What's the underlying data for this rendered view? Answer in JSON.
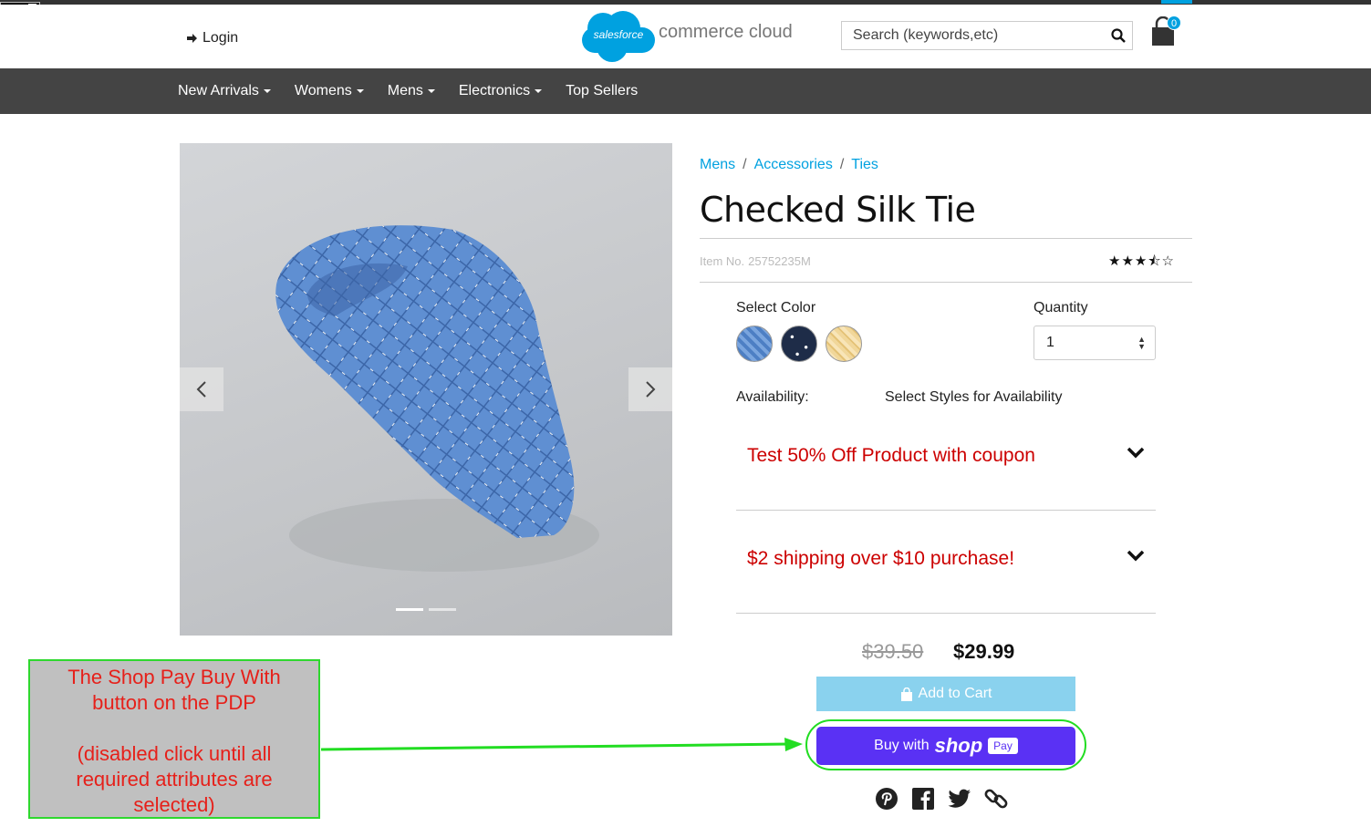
{
  "toolbox": {
    "icon": "tools-icon",
    "close": "×"
  },
  "header": {
    "login_label": "Login",
    "logo_cloud_text": "salesforce",
    "logo_text": "commerce cloud",
    "search_placeholder": "Search (keywords,etc)",
    "cart_count": "0"
  },
  "nav": {
    "items": [
      {
        "label": "New Arrivals"
      },
      {
        "label": "Womens"
      },
      {
        "label": "Mens"
      },
      {
        "label": "Electronics"
      },
      {
        "label": "Top Sellers"
      }
    ]
  },
  "product": {
    "breadcrumb": [
      "Mens",
      "Accessories",
      "Ties"
    ],
    "breadcrumb_sep": "/",
    "title": "Checked Silk Tie",
    "item_no_label": "Item No.",
    "item_no": "25752235M",
    "rating": 3.5,
    "rating_stars": "★★★⯪☆",
    "select_color_label": "Select Color",
    "colors": [
      "blue",
      "navy",
      "yellow"
    ],
    "quantity_label": "Quantity",
    "quantity_value": "1",
    "availability_label": "Availability:",
    "availability_value": "Select Styles for Availability",
    "promotions": [
      {
        "text": "Test 50% Off Product with coupon"
      },
      {
        "text": "$2 shipping over $10 purchase!"
      }
    ],
    "price_old": "$39.50",
    "price_new": "$29.99",
    "add_to_cart_label": "Add to Cart",
    "shop_pay": {
      "prefix": "Buy with",
      "brand": "shop",
      "pay": "Pay"
    },
    "gallery": {
      "slides": 2,
      "active_slide": 1
    }
  },
  "annotation": {
    "line1": "The Shop Pay Buy With",
    "line2": "button on the PDP",
    "line3": "(disabled click until all",
    "line4": "required attributes are",
    "line5": "selected)"
  },
  "colors": {
    "accent": "#00a1e0",
    "nav_bg": "#444444",
    "promo_text": "#cc0000",
    "shop_pay": "#5a31f4",
    "add_to_cart": "#8ad2ee",
    "highlight": "#22dd22"
  }
}
